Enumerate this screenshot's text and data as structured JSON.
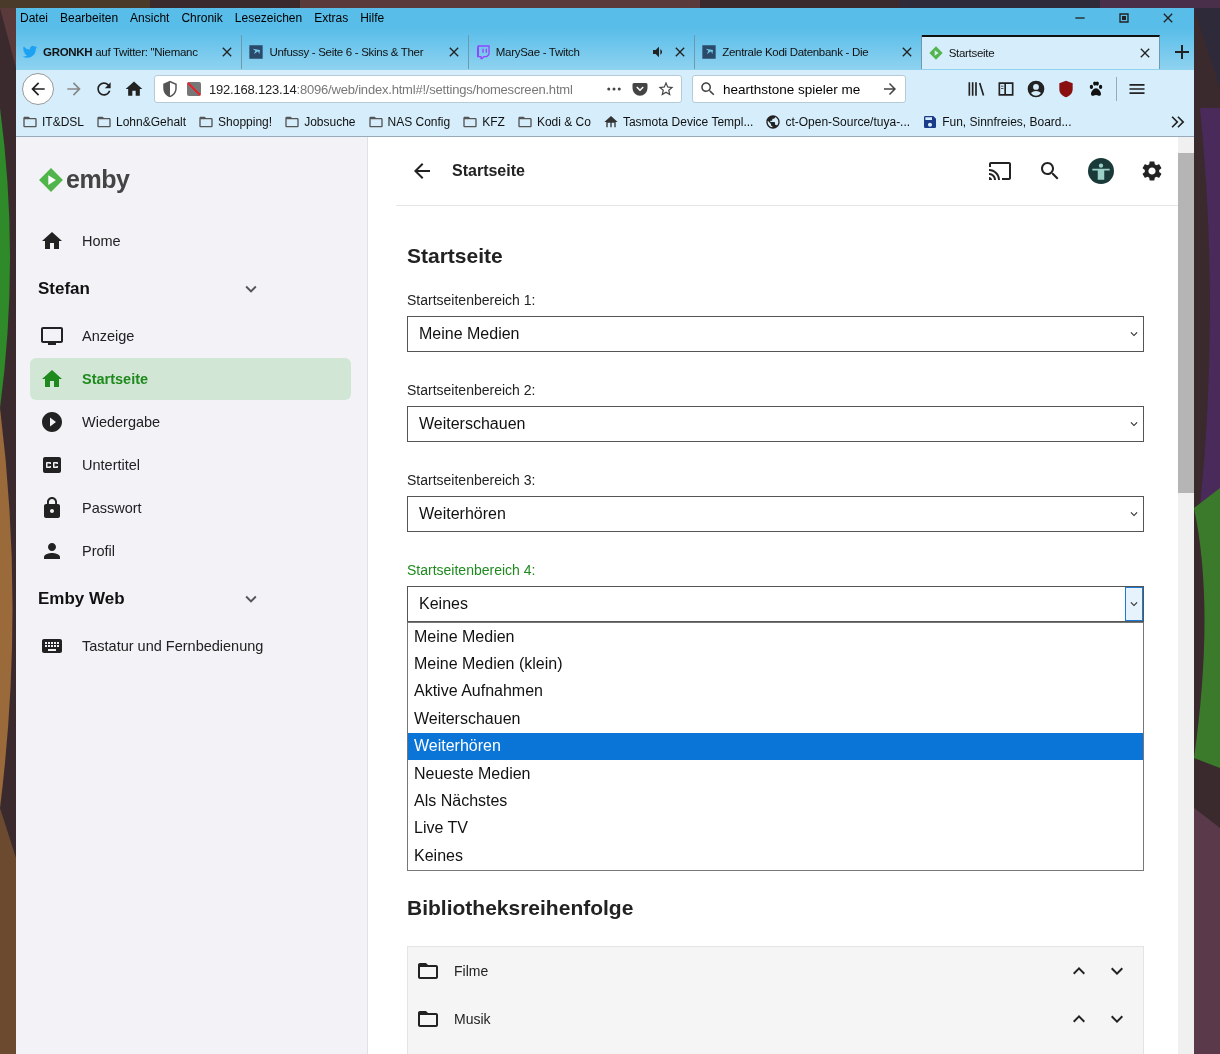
{
  "window": {
    "menu": [
      "Datei",
      "Bearbeiten",
      "Ansicht",
      "Chronik",
      "Lesezeichen",
      "Extras",
      "Hilfe"
    ]
  },
  "tabs": [
    {
      "title": "**GRONKH** auf Twitter: \"Niemanc",
      "kind": "bird",
      "audio": false,
      "selected": false
    },
    {
      "title": "Unfussy - Seite 6 - Skins & Ther",
      "kind": "forum",
      "audio": false,
      "selected": false
    },
    {
      "title": "MarySae - Twitch",
      "kind": "stream",
      "audio": true,
      "selected": false
    },
    {
      "title": "Zentrale Kodi Datenbank - Die",
      "kind": "forum",
      "audio": false,
      "selected": false
    },
    {
      "title": "Startseite",
      "kind": "emby",
      "audio": false,
      "selected": true
    }
  ],
  "nav": {
    "url_host": "192.168.123.14",
    "url_path": ":8096/web/index.html#!/settings/homescreen.html",
    "search_value": "hearthstone spieler me"
  },
  "bookmarks": [
    {
      "label": "IT&DSL",
      "kind": "folder"
    },
    {
      "label": "Lohn&Gehalt",
      "kind": "folder"
    },
    {
      "label": "Shopping!",
      "kind": "folder"
    },
    {
      "label": "Jobsuche",
      "kind": "folder"
    },
    {
      "label": "NAS Config",
      "kind": "folder"
    },
    {
      "label": "KFZ",
      "kind": "folder"
    },
    {
      "label": "Kodi & Co",
      "kind": "folder"
    },
    {
      "label": "Tasmota Device Templ...",
      "kind": "site"
    },
    {
      "label": "ct-Open-Source/tuya-...",
      "kind": "globe"
    },
    {
      "label": "Fun, Sinnfreies, Board...",
      "kind": "disk"
    }
  ],
  "sidebar": {
    "logo": "emby",
    "items": [
      {
        "label": "Home",
        "kind": "home",
        "selected": false
      }
    ],
    "sections": [
      {
        "title": "Stefan",
        "expanded": true,
        "items": [
          {
            "label": "Anzeige",
            "kind": "monitor",
            "selected": false
          },
          {
            "label": "Startseite",
            "kind": "home",
            "selected": true
          },
          {
            "label": "Wiedergabe",
            "kind": "play",
            "selected": false
          },
          {
            "label": "Untertitel",
            "kind": "cc",
            "selected": false
          },
          {
            "label": "Passwort",
            "kind": "lock",
            "selected": false
          },
          {
            "label": "Profil",
            "kind": "person",
            "selected": false
          }
        ]
      },
      {
        "title": "Emby Web",
        "expanded": true,
        "items": [
          {
            "label": "Tastatur und Fernbedienung",
            "kind": "keyboard",
            "selected": false
          }
        ]
      }
    ]
  },
  "header": {
    "title": "Startseite"
  },
  "page": {
    "heading": "Startseite",
    "fields": [
      {
        "label": "Startseitenbereich 1:",
        "value": "Meine Medien",
        "focused": false,
        "expanded": false
      },
      {
        "label": "Startseitenbereich 2:",
        "value": "Weiterschauen",
        "focused": false,
        "expanded": false
      },
      {
        "label": "Startseitenbereich 3:",
        "value": "Weiterhören",
        "focused": false,
        "expanded": false
      },
      {
        "label": "Startseitenbereich 4:",
        "value": "Keines",
        "focused": true,
        "expanded": true,
        "options": [
          {
            "label": "Meine Medien",
            "highlighted": false
          },
          {
            "label": "Meine Medien (klein)",
            "highlighted": false
          },
          {
            "label": "Aktive Aufnahmen",
            "highlighted": false
          },
          {
            "label": "Weiterschauen",
            "highlighted": false
          },
          {
            "label": "Weiterhören",
            "highlighted": true
          },
          {
            "label": "Neueste Medien",
            "highlighted": false
          },
          {
            "label": "Als Nächstes",
            "highlighted": false
          },
          {
            "label": "Live TV",
            "highlighted": false
          },
          {
            "label": "Keines",
            "highlighted": false
          }
        ]
      }
    ],
    "library_heading": "Bibliotheksreihenfolge",
    "libraries": [
      {
        "label": "Filme"
      },
      {
        "label": "Musik"
      }
    ]
  }
}
